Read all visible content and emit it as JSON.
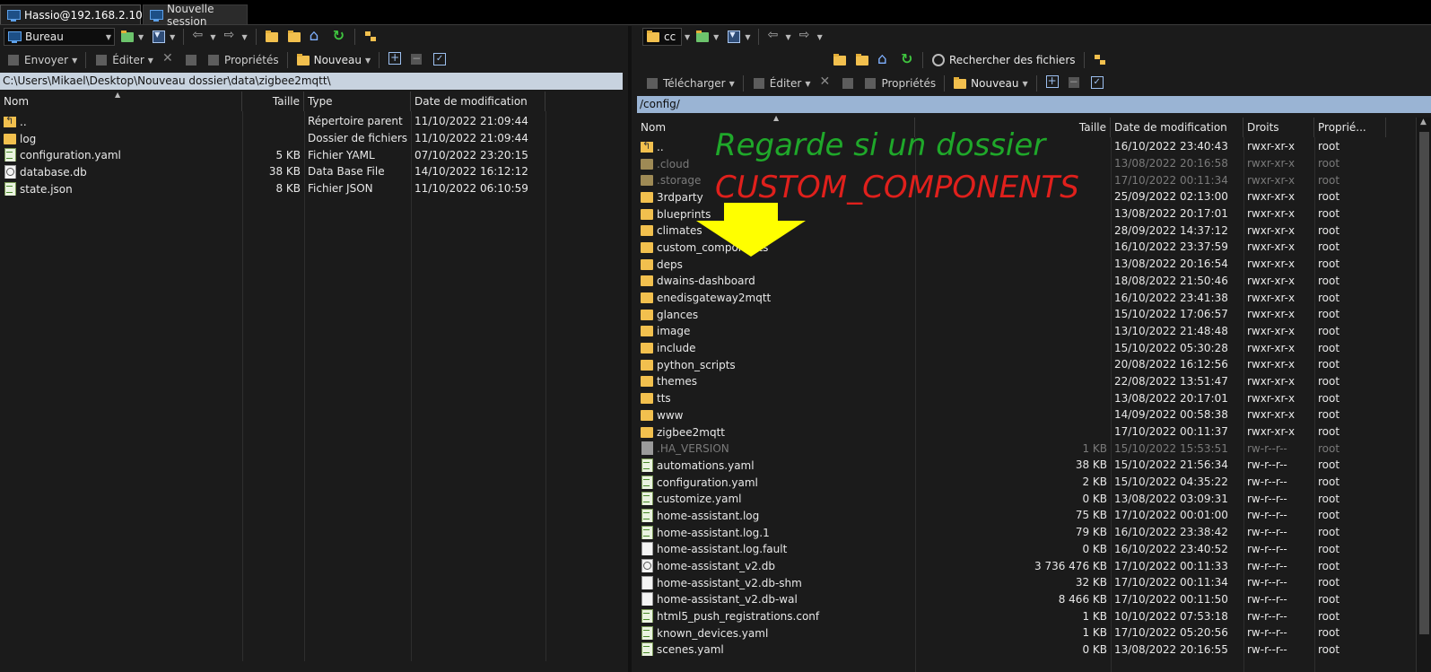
{
  "tabs": [
    {
      "label": "Hassio@192.168.2.10",
      "icon": "monitor-icon"
    },
    {
      "label": "Nouvelle session",
      "icon": "new-session-icon"
    }
  ],
  "left": {
    "location": "Bureau",
    "toolbar": {
      "send": "Envoyer",
      "edit": "Éditer",
      "properties": "Propriétés",
      "new": "Nouveau"
    },
    "path": "C:\\Users\\Mikael\\Desktop\\Nouveau dossier\\data\\zigbee2mqtt\\",
    "columns": {
      "name": "Nom",
      "size": "Taille",
      "type": "Type",
      "modified": "Date de modification"
    },
    "rows": [
      {
        "name": "..",
        "size": "",
        "type": "Répertoire parent",
        "modified": "11/10/2022  21:09:44",
        "icon": "up"
      },
      {
        "name": "log",
        "size": "",
        "type": "Dossier de fichiers",
        "modified": "11/10/2022  21:09:44",
        "icon": "folder"
      },
      {
        "name": "configuration.yaml",
        "size": "5 KB",
        "type": "Fichier YAML",
        "modified": "07/10/2022  23:20:15",
        "icon": "yaml"
      },
      {
        "name": "database.db",
        "size": "38 KB",
        "type": "Data Base File",
        "modified": "14/10/2022  16:12:12",
        "icon": "db"
      },
      {
        "name": "state.json",
        "size": "8 KB",
        "type": "Fichier JSON",
        "modified": "11/10/2022  06:10:59",
        "icon": "yaml"
      }
    ]
  },
  "right": {
    "location": "cc",
    "search": "Rechercher des fichiers",
    "toolbar": {
      "download": "Télécharger",
      "edit": "Éditer",
      "properties": "Propriétés",
      "new": "Nouveau"
    },
    "path": "/config/",
    "columns": {
      "name": "Nom",
      "size": "Taille",
      "modified": "Date de modification",
      "rights": "Droits",
      "owner": "Proprié..."
    },
    "rows": [
      {
        "name": "..",
        "size": "",
        "modified": "16/10/2022 23:40:43",
        "rights": "rwxr-xr-x",
        "owner": "root",
        "icon": "up",
        "dim": false
      },
      {
        "name": ".cloud",
        "size": "",
        "modified": "13/08/2022 20:16:58",
        "rights": "rwxr-xr-x",
        "owner": "root",
        "icon": "folder",
        "dim": true
      },
      {
        "name": ".storage",
        "size": "",
        "modified": "17/10/2022 00:11:34",
        "rights": "rwxr-xr-x",
        "owner": "root",
        "icon": "folder",
        "dim": true
      },
      {
        "name": "3rdparty",
        "size": "",
        "modified": "25/09/2022 02:13:00",
        "rights": "rwxr-xr-x",
        "owner": "root",
        "icon": "folder",
        "dim": false
      },
      {
        "name": "blueprints",
        "size": "",
        "modified": "13/08/2022 20:17:01",
        "rights": "rwxr-xr-x",
        "owner": "root",
        "icon": "folder",
        "dim": false
      },
      {
        "name": "climates",
        "size": "",
        "modified": "28/09/2022 14:37:12",
        "rights": "rwxr-xr-x",
        "owner": "root",
        "icon": "folder",
        "dim": false
      },
      {
        "name": "custom_components",
        "size": "",
        "modified": "16/10/2022 23:37:59",
        "rights": "rwxr-xr-x",
        "owner": "root",
        "icon": "folder",
        "dim": false
      },
      {
        "name": "deps",
        "size": "",
        "modified": "13/08/2022 20:16:54",
        "rights": "rwxr-xr-x",
        "owner": "root",
        "icon": "folder",
        "dim": false
      },
      {
        "name": "dwains-dashboard",
        "size": "",
        "modified": "18/08/2022 21:50:46",
        "rights": "rwxr-xr-x",
        "owner": "root",
        "icon": "folder",
        "dim": false
      },
      {
        "name": "enedisgateway2mqtt",
        "size": "",
        "modified": "16/10/2022 23:41:38",
        "rights": "rwxr-xr-x",
        "owner": "root",
        "icon": "folder",
        "dim": false
      },
      {
        "name": "glances",
        "size": "",
        "modified": "15/10/2022 17:06:57",
        "rights": "rwxr-xr-x",
        "owner": "root",
        "icon": "folder",
        "dim": false
      },
      {
        "name": "image",
        "size": "",
        "modified": "13/10/2022 21:48:48",
        "rights": "rwxr-xr-x",
        "owner": "root",
        "icon": "folder",
        "dim": false
      },
      {
        "name": "include",
        "size": "",
        "modified": "15/10/2022 05:30:28",
        "rights": "rwxr-xr-x",
        "owner": "root",
        "icon": "folder",
        "dim": false
      },
      {
        "name": "python_scripts",
        "size": "",
        "modified": "20/08/2022 16:12:56",
        "rights": "rwxr-xr-x",
        "owner": "root",
        "icon": "folder",
        "dim": false
      },
      {
        "name": "themes",
        "size": "",
        "modified": "22/08/2022 13:51:47",
        "rights": "rwxr-xr-x",
        "owner": "root",
        "icon": "folder",
        "dim": false
      },
      {
        "name": "tts",
        "size": "",
        "modified": "13/08/2022 20:17:01",
        "rights": "rwxr-xr-x",
        "owner": "root",
        "icon": "folder",
        "dim": false
      },
      {
        "name": "www",
        "size": "",
        "modified": "14/09/2022 00:58:38",
        "rights": "rwxr-xr-x",
        "owner": "root",
        "icon": "folder",
        "dim": false
      },
      {
        "name": "zigbee2mqtt",
        "size": "",
        "modified": "17/10/2022 00:11:37",
        "rights": "rwxr-xr-x",
        "owner": "root",
        "icon": "folder",
        "dim": false
      },
      {
        "name": ".HA_VERSION",
        "size": "1 KB",
        "modified": "15/10/2022 15:53:51",
        "rights": "rw-r--r--",
        "owner": "root",
        "icon": "doc",
        "dim": true
      },
      {
        "name": "automations.yaml",
        "size": "38 KB",
        "modified": "15/10/2022 21:56:34",
        "rights": "rw-r--r--",
        "owner": "root",
        "icon": "yaml",
        "dim": false
      },
      {
        "name": "configuration.yaml",
        "size": "2 KB",
        "modified": "15/10/2022 04:35:22",
        "rights": "rw-r--r--",
        "owner": "root",
        "icon": "yaml",
        "dim": false
      },
      {
        "name": "customize.yaml",
        "size": "0 KB",
        "modified": "13/08/2022 03:09:31",
        "rights": "rw-r--r--",
        "owner": "root",
        "icon": "yaml",
        "dim": false
      },
      {
        "name": "home-assistant.log",
        "size": "75 KB",
        "modified": "17/10/2022 00:01:00",
        "rights": "rw-r--r--",
        "owner": "root",
        "icon": "yaml",
        "dim": false
      },
      {
        "name": "home-assistant.log.1",
        "size": "79 KB",
        "modified": "16/10/2022 23:38:42",
        "rights": "rw-r--r--",
        "owner": "root",
        "icon": "yaml",
        "dim": false
      },
      {
        "name": "home-assistant.log.fault",
        "size": "0 KB",
        "modified": "16/10/2022 23:40:52",
        "rights": "rw-r--r--",
        "owner": "root",
        "icon": "doc",
        "dim": false
      },
      {
        "name": "home-assistant_v2.db",
        "size": "3 736 476 KB",
        "modified": "17/10/2022 00:11:33",
        "rights": "rw-r--r--",
        "owner": "root",
        "icon": "db",
        "dim": false
      },
      {
        "name": "home-assistant_v2.db-shm",
        "size": "32 KB",
        "modified": "17/10/2022 00:11:34",
        "rights": "rw-r--r--",
        "owner": "root",
        "icon": "doc",
        "dim": false
      },
      {
        "name": "home-assistant_v2.db-wal",
        "size": "8 466 KB",
        "modified": "17/10/2022 00:11:50",
        "rights": "rw-r--r--",
        "owner": "root",
        "icon": "doc",
        "dim": false
      },
      {
        "name": "html5_push_registrations.conf",
        "size": "1 KB",
        "modified": "10/10/2022 07:53:18",
        "rights": "rw-r--r--",
        "owner": "root",
        "icon": "yaml",
        "dim": false
      },
      {
        "name": "known_devices.yaml",
        "size": "1 KB",
        "modified": "17/10/2022 05:20:56",
        "rights": "rw-r--r--",
        "owner": "root",
        "icon": "yaml",
        "dim": false
      },
      {
        "name": "scenes.yaml",
        "size": "0 KB",
        "modified": "13/08/2022 20:16:55",
        "rights": "rw-r--r--",
        "owner": "root",
        "icon": "yaml",
        "dim": false
      }
    ]
  },
  "annotation": {
    "line1": "Regarde si un dossier",
    "line2": "CUSTOM_COMPONENTS",
    "color1": "#1fa82a",
    "color2": "#e0201c",
    "arrow_color": "#ffff00"
  }
}
